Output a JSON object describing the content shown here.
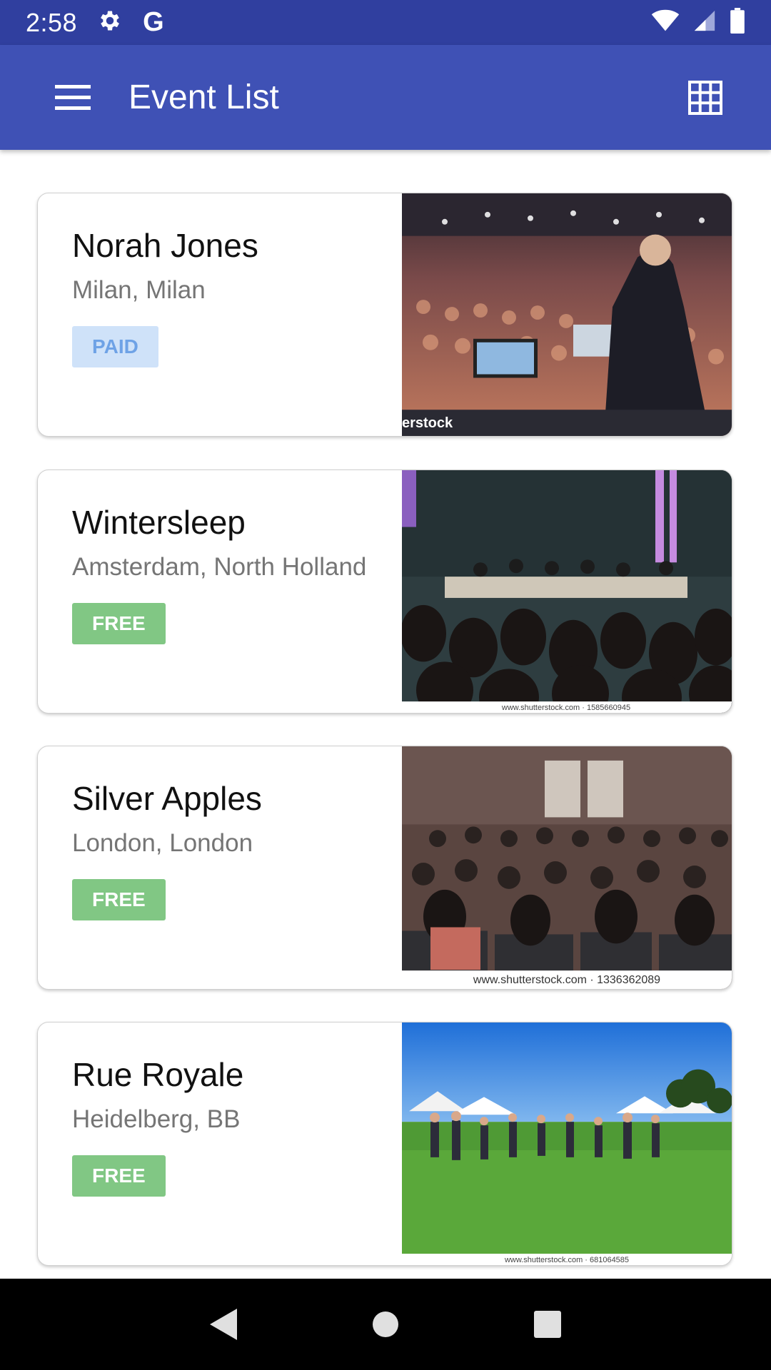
{
  "status_bar": {
    "time": "2:58",
    "icons": [
      "gear-icon",
      "google-g-icon",
      "wifi-icon",
      "cellular-signal-icon",
      "battery-icon"
    ],
    "google_letter": "G"
  },
  "app_bar": {
    "title": "Event List",
    "menu_icon": "hamburger-menu-icon",
    "view_icon": "grid-view-icon",
    "background": "#3f51b5",
    "status_background": "#303f9f"
  },
  "events": [
    {
      "title": "Norah Jones",
      "location": "Milan, Milan",
      "badge": "PAID",
      "badge_type": "paid",
      "image": "conference-speaker-photo",
      "image_caption": "erstock"
    },
    {
      "title": "Wintersleep",
      "location": "Amsterdam, North Holland",
      "badge": "FREE",
      "badge_type": "free",
      "image": "audience-seminar-photo",
      "image_caption": "www.shutterstock.com · 1585660945"
    },
    {
      "title": "Silver Apples",
      "location": "London, London",
      "badge": "FREE",
      "badge_type": "free",
      "image": "audience-hall-photo",
      "image_caption": "www.shutterstock.com · 1336362089"
    },
    {
      "title": "Rue Royale",
      "location": "Heidelberg, BB",
      "badge": "FREE",
      "badge_type": "free",
      "image": "outdoor-festival-photo",
      "image_caption": "www.shutterstock.com · 681064585"
    }
  ],
  "colors": {
    "paid_badge_bg": "#cfe2f9",
    "paid_badge_text": "#6ea2e6",
    "free_badge_bg": "#81c784"
  },
  "nav_bar": {
    "icons": [
      "back-icon",
      "home-icon",
      "recents-icon"
    ]
  }
}
